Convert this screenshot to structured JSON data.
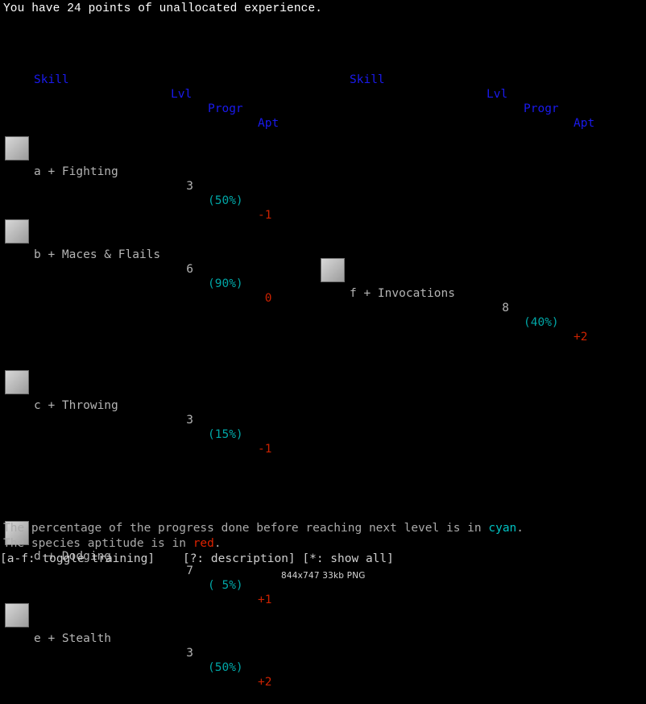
{
  "message": "You have 24 points of unallocated experience.",
  "columns": {
    "skill": "Skill",
    "lvl": "Lvl",
    "progr": "Progr",
    "apt": "Apt"
  },
  "panels": [
    {
      "id": "left",
      "rows": [
        {
          "kind": "skill",
          "icon": "fighting-icon",
          "key": "a",
          "toggle": "+",
          "name": "a + Fighting",
          "lvl": "3",
          "progr": "(50%)",
          "apt": "-1"
        },
        {
          "kind": "skill",
          "icon": "maces-flails-icon",
          "key": "b",
          "toggle": "+",
          "name": "b + Maces & Flails",
          "lvl": "6",
          "progr": "(90%)",
          "apt": " 0"
        },
        {
          "kind": "spacer"
        },
        {
          "kind": "skill",
          "icon": "throwing-icon",
          "key": "c",
          "toggle": "+",
          "name": "c + Throwing",
          "lvl": "3",
          "progr": "(15%)",
          "apt": "-1"
        },
        {
          "kind": "spacer"
        },
        {
          "kind": "skill",
          "icon": "dodging-icon",
          "key": "d",
          "toggle": "+",
          "name": "d + Dodging",
          "lvl": "7",
          "progr": "( 5%)",
          "apt": "+1"
        },
        {
          "kind": "skill",
          "icon": "stealth-icon",
          "key": "e",
          "toggle": "+",
          "name": "e + Stealth",
          "lvl": "3",
          "progr": "(50%)",
          "apt": "+2"
        }
      ]
    },
    {
      "id": "right",
      "rows": [
        {
          "kind": "spacer"
        },
        {
          "kind": "spacer"
        },
        {
          "kind": "spacer"
        },
        {
          "kind": "skill",
          "icon": "invocations-icon",
          "key": "f",
          "toggle": "+",
          "name": "f + Invocations",
          "lvl": "8",
          "progr": "(40%)",
          "apt": "+2"
        }
      ]
    }
  ],
  "legend": {
    "line1_prefix": "The percentage of the progress done before reaching next level is in ",
    "line1_cyan": "cyan",
    "line1_suffix": ".",
    "line2_prefix": "The species aptitude is in ",
    "line2_red": "red",
    "line2_suffix": "."
  },
  "commands": "[a-f: toggle training]    [?: description] [*: show all]",
  "watermark": "844x747 33kb PNG",
  "colors": {
    "background": "#000000",
    "header": "#1a1aee",
    "skill_text": "#b4b4b4",
    "progress": "#00a6a6",
    "aptitude": "#cc2200",
    "message": "#ffffff",
    "legend": "#aaaaaa"
  }
}
